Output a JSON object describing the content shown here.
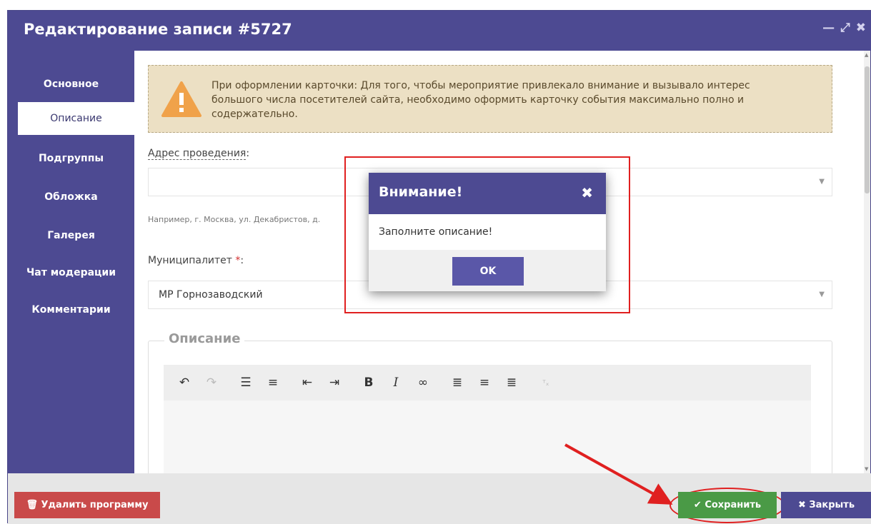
{
  "window": {
    "title": "Редактирование записи #5727",
    "controls": {
      "minimize": "—",
      "maximize": "⤢",
      "close": "✖"
    }
  },
  "sidebar": {
    "items": [
      {
        "label": "Основное",
        "active": false
      },
      {
        "label": "Описание",
        "active": true
      },
      {
        "label": "Подгруппы",
        "active": false
      },
      {
        "label": "Обложка",
        "active": false
      },
      {
        "label": "Галерея",
        "active": false
      },
      {
        "label": "Чат модерации",
        "active": false
      },
      {
        "label": "Комментарии",
        "active": false
      }
    ]
  },
  "warning": {
    "text": "При оформлении карточки: Для того, чтобы мероприятие привлекало внимание и вызывало интерес большого числа посетителей сайта, необходимо оформить карточку события максимально полно и содержательно."
  },
  "address": {
    "label": "Адрес проведения",
    "colon": ":",
    "value": "",
    "hint": "Например, г. Москва, ул. Декабристов, д."
  },
  "municipality": {
    "label": "Муниципалитет",
    "required_mark": "*",
    "colon": ":",
    "value": "МР Горнозаводский"
  },
  "description": {
    "legend": "Описание",
    "toolbar_icons": [
      "undo-icon",
      "redo-icon",
      "bullet-list-icon",
      "numbered-list-icon",
      "outdent-icon",
      "indent-icon",
      "bold-icon",
      "italic-icon",
      "link-icon",
      "align-left-icon",
      "align-center-icon",
      "align-right-icon",
      "clear-format-icon"
    ],
    "toolbar_labels": {
      "bold": "B",
      "italic": "I"
    },
    "value": ""
  },
  "modal": {
    "title": "Внимание!",
    "close": "✖",
    "message": "Заполните описание!",
    "ok_label": "OK"
  },
  "footer": {
    "delete_label": "Удалить программу",
    "delete_icon": "🗑",
    "save_label": "Сохранить",
    "save_icon": "✔",
    "close_label": "Закрыть",
    "close_icon": "✖"
  },
  "colors": {
    "primary": "#4d4a92",
    "warning_bg": "#ece0c4",
    "warning_icon": "#f0a24a",
    "danger": "#c94a4a",
    "success": "#4a9a46",
    "annotation_red": "#e02020"
  }
}
